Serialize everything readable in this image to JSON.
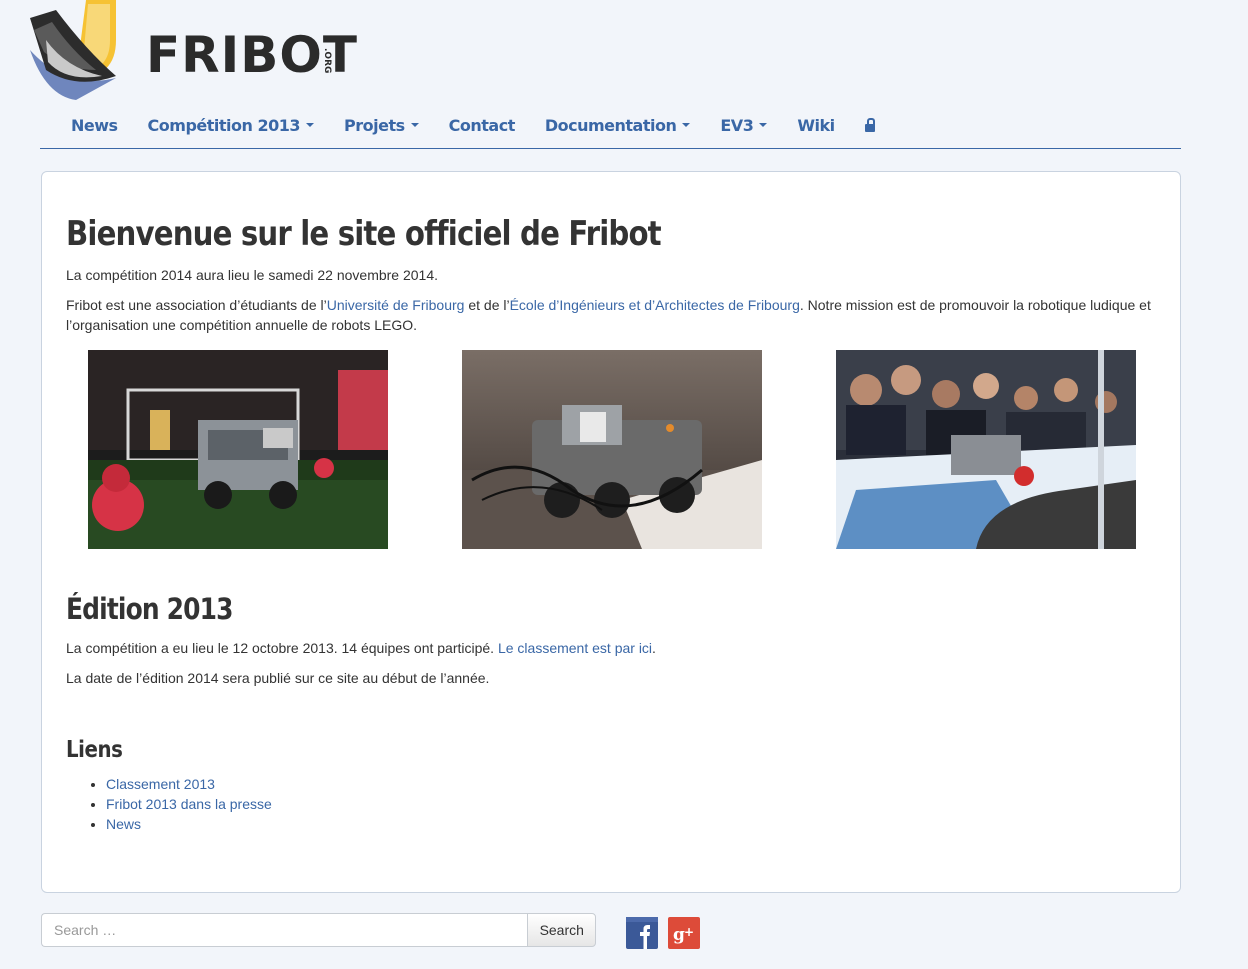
{
  "logo": {
    "text": "FRIBOT",
    "suffix": ".ORG"
  },
  "nav": [
    {
      "label": "News",
      "dropdown": false
    },
    {
      "label": "Compétition 2013",
      "dropdown": true
    },
    {
      "label": "Projets",
      "dropdown": true
    },
    {
      "label": "Contact",
      "dropdown": false
    },
    {
      "label": "Documentation",
      "dropdown": true
    },
    {
      "label": "EV3",
      "dropdown": true
    },
    {
      "label": "Wiki",
      "dropdown": false
    }
  ],
  "main": {
    "title": "Bienvenue sur le site officiel de Fribot",
    "intro": "La compétition 2014 aura lieu le samedi 22 novembre 2014.",
    "mission": {
      "before": "Fribot est une association d’étudiants de l’",
      "link1": "Université de Fribourg",
      "middle": " et de l’",
      "link2": "École d’Ingénieurs et d’Architectes de Fribourg",
      "after": ". Notre mission est de promouvoir la robotique ludique et l’organisation une compétition annuelle de robots LEGO."
    },
    "edition_title": "Édition 2013",
    "edition_text": {
      "before": "La compétition a eu lieu le 12 octobre 2013. 14 équipes ont participé. ",
      "link": "Le classement est par ici",
      "after": "."
    },
    "edition_note": "La date de l’édition 2014 sera publié sur ce site au début de l’année.",
    "links_title": "Liens",
    "links": [
      "Classement 2013",
      "Fribot 2013 dans la presse",
      "News"
    ]
  },
  "search": {
    "placeholder": "Search …",
    "button": "Search"
  },
  "colors": {
    "link": "#3a67a6",
    "facebook": "#3b5998",
    "googleplus": "#dd4b39"
  }
}
